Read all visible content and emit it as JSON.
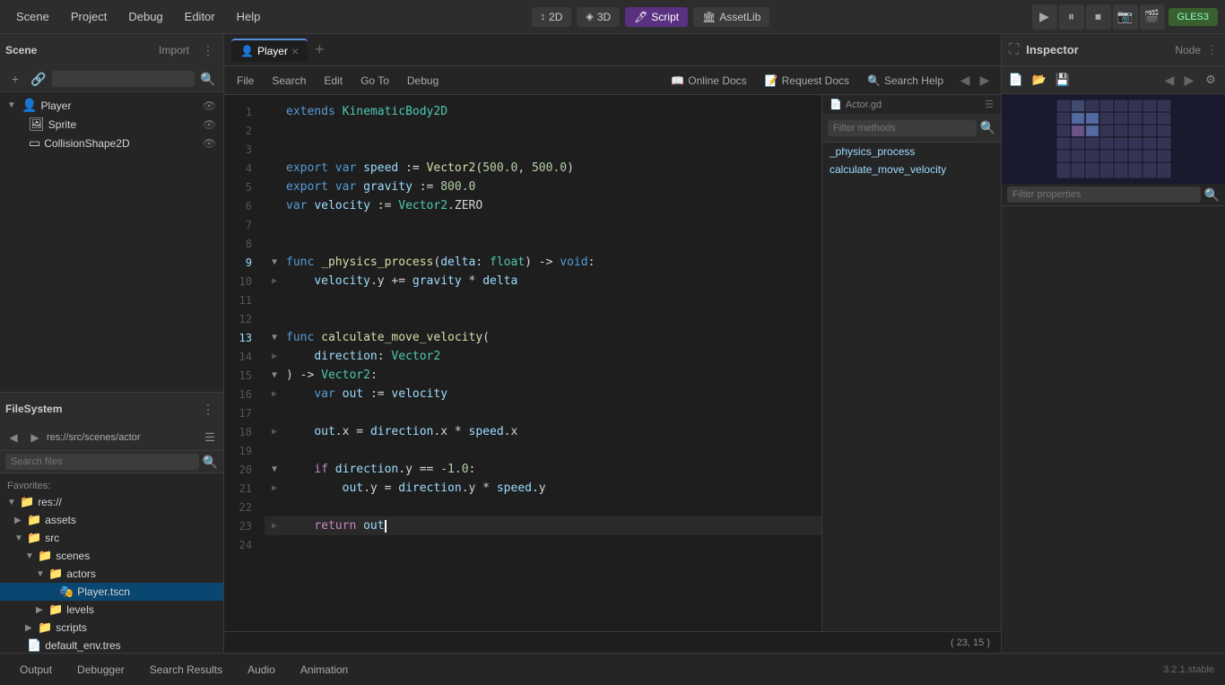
{
  "menubar": {
    "items": [
      "Scene",
      "Project",
      "Debug",
      "Editor",
      "Help"
    ],
    "modes": {
      "2d": "2D",
      "3d": "3D",
      "script": "Script",
      "assetlib": "AssetLib"
    },
    "gles": "GLES3"
  },
  "controls": {
    "play": "▶",
    "pause": "⏸",
    "stop": "⏹",
    "camera1": "📷",
    "camera2": "🎬"
  },
  "scene": {
    "title": "Scene",
    "import_btn": "Import",
    "player": "Player",
    "sprite": "Sprite",
    "collision": "CollisionShape2D"
  },
  "filesystem": {
    "title": "FileSystem",
    "path": "res://src/scenes/actor",
    "search_placeholder": "Search files",
    "favorites": "Favorites:",
    "items": [
      {
        "label": "res://",
        "indent": 0,
        "type": "folder",
        "open": true
      },
      {
        "label": "assets",
        "indent": 1,
        "type": "folder",
        "open": false
      },
      {
        "label": "src",
        "indent": 1,
        "type": "folder",
        "open": true
      },
      {
        "label": "scenes",
        "indent": 2,
        "type": "folder",
        "open": true
      },
      {
        "label": "actors",
        "indent": 3,
        "type": "folder",
        "open": true
      },
      {
        "label": "Player.tscn",
        "indent": 4,
        "type": "file-scene",
        "selected": true
      },
      {
        "label": "levels",
        "indent": 3,
        "type": "folder",
        "open": false
      },
      {
        "label": "scripts",
        "indent": 2,
        "type": "folder",
        "open": false
      },
      {
        "label": "default_env.tres",
        "indent": 1,
        "type": "file-res"
      }
    ]
  },
  "tabs": [
    {
      "label": "Player",
      "icon": "👤",
      "active": true,
      "closeable": true
    }
  ],
  "script_toolbar": {
    "file": "File",
    "search": "Search",
    "edit": "Edit",
    "go_to": "Go To",
    "debug": "Debug",
    "online_docs": "Online Docs",
    "request_docs": "Request Docs",
    "search_help": "Search Help"
  },
  "methods_panel": {
    "file_label": "Actor.gd",
    "filter_placeholder": "Filter methods",
    "methods": [
      "_physics_process",
      "calculate_move_velocity"
    ]
  },
  "code": {
    "file": "Actor.gd",
    "lines": [
      {
        "n": 1,
        "code": "extends KinematicBody2D",
        "tokens": [
          {
            "t": "kw",
            "v": "extends"
          },
          {
            "t": "plain",
            "v": " "
          },
          {
            "t": "type",
            "v": "KinematicBody2D"
          }
        ]
      },
      {
        "n": 2,
        "code": "",
        "tokens": []
      },
      {
        "n": 3,
        "code": "",
        "tokens": []
      },
      {
        "n": 4,
        "code": "export var speed := Vector2(500.0, 500.0)",
        "tokens": [
          {
            "t": "kw",
            "v": "export"
          },
          {
            "t": "plain",
            "v": " "
          },
          {
            "t": "kw",
            "v": "var"
          },
          {
            "t": "plain",
            "v": " "
          },
          {
            "t": "var-name",
            "v": "speed"
          },
          {
            "t": "plain",
            "v": " := "
          },
          {
            "t": "fn",
            "v": "Vector2"
          },
          {
            "t": "plain",
            "v": "("
          },
          {
            "t": "num",
            "v": "500.0"
          },
          {
            "t": "plain",
            "v": ", "
          },
          {
            "t": "num",
            "v": "500.0"
          },
          {
            "t": "plain",
            "v": ")"
          }
        ]
      },
      {
        "n": 5,
        "code": "export var gravity := 800.0",
        "tokens": [
          {
            "t": "kw",
            "v": "export"
          },
          {
            "t": "plain",
            "v": " "
          },
          {
            "t": "kw",
            "v": "var"
          },
          {
            "t": "plain",
            "v": " "
          },
          {
            "t": "var-name",
            "v": "gravity"
          },
          {
            "t": "plain",
            "v": " := "
          },
          {
            "t": "num",
            "v": "800.0"
          }
        ]
      },
      {
        "n": 6,
        "code": "var velocity := Vector2.ZERO",
        "tokens": [
          {
            "t": "kw",
            "v": "var"
          },
          {
            "t": "plain",
            "v": " "
          },
          {
            "t": "var-name",
            "v": "velocity"
          },
          {
            "t": "plain",
            "v": " := "
          },
          {
            "t": "type",
            "v": "Vector2"
          },
          {
            "t": "plain",
            "v": ".ZERO"
          }
        ]
      },
      {
        "n": 7,
        "code": "",
        "tokens": []
      },
      {
        "n": 8,
        "code": "",
        "tokens": []
      },
      {
        "n": 9,
        "code": "func _physics_process(delta: float) -> void:",
        "tokens": [
          {
            "t": "kw",
            "v": "func"
          },
          {
            "t": "plain",
            "v": " "
          },
          {
            "t": "fn",
            "v": "_physics_process"
          },
          {
            "t": "plain",
            "v": "("
          },
          {
            "t": "var-name",
            "v": "delta"
          },
          {
            "t": "plain",
            "v": ": "
          },
          {
            "t": "type",
            "v": "float"
          },
          {
            "t": "plain",
            "v": ") -> "
          },
          {
            "t": "kw",
            "v": "void"
          },
          {
            "t": "plain",
            "v": ":"
          }
        ]
      },
      {
        "n": 10,
        "code": "    velocity.y += gravity * delta",
        "tokens": [
          {
            "t": "plain",
            "v": "    "
          },
          {
            "t": "var-name",
            "v": "velocity"
          },
          {
            "t": "plain",
            "v": ".y += "
          },
          {
            "t": "var-name",
            "v": "gravity"
          },
          {
            "t": "plain",
            "v": " * "
          },
          {
            "t": "var-name",
            "v": "delta"
          }
        ]
      },
      {
        "n": 11,
        "code": "",
        "tokens": []
      },
      {
        "n": 12,
        "code": "",
        "tokens": []
      },
      {
        "n": 13,
        "code": "func calculate_move_velocity(",
        "tokens": [
          {
            "t": "kw",
            "v": "func"
          },
          {
            "t": "plain",
            "v": " "
          },
          {
            "t": "fn",
            "v": "calculate_move_velocity"
          },
          {
            "t": "plain",
            "v": "("
          }
        ]
      },
      {
        "n": 14,
        "code": "    direction: Vector2",
        "tokens": [
          {
            "t": "plain",
            "v": "    "
          },
          {
            "t": "var-name",
            "v": "direction"
          },
          {
            "t": "plain",
            "v": ": "
          },
          {
            "t": "type",
            "v": "Vector2"
          }
        ]
      },
      {
        "n": 15,
        "code": ") -> Vector2:",
        "tokens": [
          {
            "t": "plain",
            "v": ") -> "
          },
          {
            "t": "type",
            "v": "Vector2"
          },
          {
            "t": "plain",
            "v": ":"
          }
        ]
      },
      {
        "n": 16,
        "code": "    var out := velocity",
        "tokens": [
          {
            "t": "plain",
            "v": "    "
          },
          {
            "t": "kw",
            "v": "var"
          },
          {
            "t": "plain",
            "v": " "
          },
          {
            "t": "var-name",
            "v": "out"
          },
          {
            "t": "plain",
            "v": " := "
          },
          {
            "t": "var-name",
            "v": "velocity"
          }
        ]
      },
      {
        "n": 17,
        "code": "",
        "tokens": []
      },
      {
        "n": 18,
        "code": "    out.x = direction.x * speed.x",
        "tokens": [
          {
            "t": "plain",
            "v": "    "
          },
          {
            "t": "var-name",
            "v": "out"
          },
          {
            "t": "plain",
            "v": ".x = "
          },
          {
            "t": "var-name",
            "v": "direction"
          },
          {
            "t": "plain",
            "v": ".x * "
          },
          {
            "t": "var-name",
            "v": "speed"
          },
          {
            "t": "plain",
            "v": ".x"
          }
        ]
      },
      {
        "n": 19,
        "code": "",
        "tokens": []
      },
      {
        "n": 20,
        "code": "    if direction.y == -1.0:",
        "tokens": [
          {
            "t": "plain",
            "v": "    "
          },
          {
            "t": "kw2",
            "v": "if"
          },
          {
            "t": "plain",
            "v": " "
          },
          {
            "t": "var-name",
            "v": "direction"
          },
          {
            "t": "plain",
            "v": ".y == "
          },
          {
            "t": "num",
            "v": "-1.0"
          },
          {
            "t": "plain",
            "v": ":"
          }
        ]
      },
      {
        "n": 21,
        "code": "        out.y = direction.y * speed.y",
        "tokens": [
          {
            "t": "plain",
            "v": "        "
          },
          {
            "t": "var-name",
            "v": "out"
          },
          {
            "t": "plain",
            "v": ".y = "
          },
          {
            "t": "var-name",
            "v": "direction"
          },
          {
            "t": "plain",
            "v": ".y * "
          },
          {
            "t": "var-name",
            "v": "speed"
          },
          {
            "t": "plain",
            "v": ".y"
          }
        ]
      },
      {
        "n": 22,
        "code": "",
        "tokens": []
      },
      {
        "n": 23,
        "code": "    return out",
        "tokens": [
          {
            "t": "plain",
            "v": "    "
          },
          {
            "t": "kw2",
            "v": "return"
          },
          {
            "t": "plain",
            "v": " "
          },
          {
            "t": "var-name",
            "v": "out"
          }
        ],
        "active": true
      },
      {
        "n": 24,
        "code": "",
        "tokens": []
      }
    ],
    "position": "( 23, 15 )"
  },
  "inspector": {
    "title": "Inspector",
    "node_btn": "Node",
    "filter_placeholder": "Filter properties"
  },
  "bottom_tabs": {
    "output": "Output",
    "debugger": "Debugger",
    "search_results": "Search Results",
    "audio": "Audio",
    "animation": "Animation",
    "version": "3.2.1.stable"
  }
}
